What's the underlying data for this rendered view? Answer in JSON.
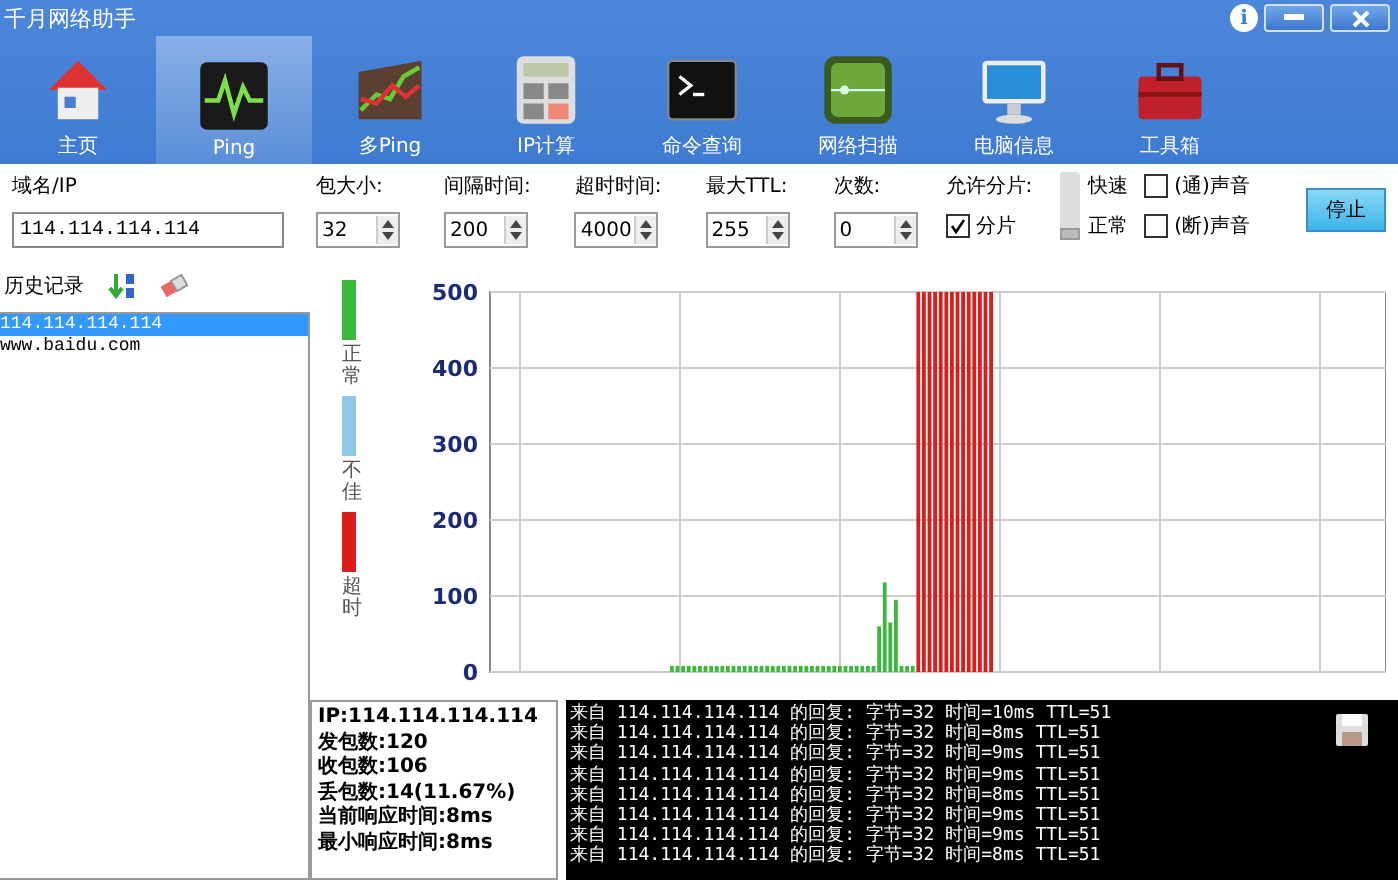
{
  "window": {
    "title": "千月网络助手",
    "info_glyph": "i"
  },
  "toolbar": [
    {
      "label": "主页",
      "selected": false
    },
    {
      "label": "Ping",
      "selected": true
    },
    {
      "label": "多Ping",
      "selected": false
    },
    {
      "label": "IP计算",
      "selected": false
    },
    {
      "label": "命令查询",
      "selected": false
    },
    {
      "label": "网络扫描",
      "selected": false
    },
    {
      "label": "电脑信息",
      "selected": false
    },
    {
      "label": "工具箱",
      "selected": false
    }
  ],
  "form": {
    "host": {
      "label": "域名/IP",
      "value": "114.114.114.114"
    },
    "spinners": [
      {
        "label": "包大小:",
        "value": "32"
      },
      {
        "label": "间隔时间:",
        "value": "200"
      },
      {
        "label": "超时时间:",
        "value": "4000"
      },
      {
        "label": "最大TTL:",
        "value": "255"
      },
      {
        "label": "次数:",
        "value": "0"
      }
    ],
    "fragment": {
      "label": "允许分片:",
      "checkbox": "分片",
      "checked": true
    },
    "speed": {
      "fast": "快速",
      "normal": "正常",
      "level": 0
    },
    "sounds": [
      {
        "label": "(通)声音",
        "checked": false
      },
      {
        "label": "(断)声音",
        "checked": false
      }
    ],
    "stop_button": "停止"
  },
  "history": {
    "title": "历史记录",
    "items": [
      {
        "text": "114.114.114.114",
        "selected": true
      },
      {
        "text": "www.baidu.com",
        "selected": false
      }
    ]
  },
  "legend": [
    {
      "label": "正常",
      "color": "#3cb93c"
    },
    {
      "label": "不佳",
      "color": "#8ecae6"
    },
    {
      "label": "超时",
      "color": "#dd1c1c"
    }
  ],
  "chart": {
    "chart_data": {
      "type": "bar",
      "ylim": [
        0,
        500
      ],
      "yticks": [
        0,
        100,
        200,
        300,
        400,
        500
      ],
      "grid": true,
      "series": [
        {
          "color": "#3cb93c",
          "values": [
            null,
            null,
            null,
            null,
            null,
            null,
            null,
            null,
            null,
            null,
            null,
            null,
            null,
            null,
            null,
            null,
            null,
            null,
            null,
            null,
            null,
            null,
            null,
            null,
            null,
            null,
            null,
            null,
            null,
            null,
            null,
            null,
            8,
            8,
            8,
            8,
            8,
            8,
            8,
            8,
            8,
            8,
            8,
            8,
            8,
            8,
            8,
            8,
            8,
            8,
            8,
            8,
            8,
            8,
            8,
            8,
            8,
            8,
            8,
            8,
            8,
            8,
            8,
            8,
            8,
            8,
            8,
            8,
            8,
            60,
            118,
            65,
            95,
            8,
            8,
            8,
            null,
            null,
            null,
            null,
            null,
            null,
            null,
            null,
            null,
            null,
            null,
            null,
            null,
            null,
            null,
            null,
            null,
            null,
            null,
            null,
            null,
            null,
            null,
            null,
            null,
            null,
            null,
            null,
            null,
            null,
            null,
            null,
            null,
            null,
            null,
            null,
            null,
            null,
            null,
            null,
            null,
            null,
            null,
            null,
            null,
            null,
            null,
            null,
            null,
            null,
            null,
            null,
            null,
            null,
            null,
            null,
            null,
            null,
            null,
            null,
            null,
            null,
            null,
            null,
            null,
            null,
            null,
            null,
            null,
            null,
            null,
            null,
            null,
            null,
            null,
            null,
            null,
            null,
            null,
            null,
            null,
            null,
            null,
            null
          ]
        },
        {
          "color": "#dd1c1c",
          "values": [
            null,
            null,
            null,
            null,
            null,
            null,
            null,
            null,
            null,
            null,
            null,
            null,
            null,
            null,
            null,
            null,
            null,
            null,
            null,
            null,
            null,
            null,
            null,
            null,
            null,
            null,
            null,
            null,
            null,
            null,
            null,
            null,
            null,
            null,
            null,
            null,
            null,
            null,
            null,
            null,
            null,
            null,
            null,
            null,
            null,
            null,
            null,
            null,
            null,
            null,
            null,
            null,
            null,
            null,
            null,
            null,
            null,
            null,
            null,
            null,
            null,
            null,
            null,
            null,
            null,
            null,
            null,
            null,
            null,
            null,
            null,
            null,
            null,
            null,
            null,
            null,
            500,
            500,
            500,
            500,
            500,
            500,
            500,
            500,
            500,
            500,
            500,
            500,
            500,
            500,
            null,
            null,
            null,
            null,
            null,
            null,
            null,
            null,
            null,
            null,
            null,
            null,
            null,
            null,
            null,
            null,
            null,
            null,
            null,
            null,
            null,
            null,
            null,
            null,
            null,
            null,
            null,
            null,
            null,
            null,
            null,
            null,
            null,
            null,
            null,
            null,
            null,
            null,
            null,
            null,
            null,
            null,
            null,
            null,
            null,
            null,
            null,
            null,
            null,
            null,
            null,
            null,
            null,
            null,
            null,
            null,
            null,
            null,
            null,
            null,
            null,
            null,
            null,
            null,
            null,
            null,
            null,
            null,
            null,
            null
          ]
        }
      ]
    }
  },
  "stats": [
    "IP:114.114.114.114",
    "发包数:120",
    "收包数:106",
    "丢包数:14(11.67%)",
    "当前响应时间:8ms",
    "最小响应时间:8ms"
  ],
  "log": [
    "来自 114.114.114.114 的回复: 字节=32 时间=10ms TTL=51",
    "来自 114.114.114.114 的回复: 字节=32 时间=8ms TTL=51",
    "来自 114.114.114.114 的回复: 字节=32 时间=9ms TTL=51",
    "来自 114.114.114.114 的回复: 字节=32 时间=9ms TTL=51",
    "来自 114.114.114.114 的回复: 字节=32 时间=8ms TTL=51",
    "来自 114.114.114.114 的回复: 字节=32 时间=9ms TTL=51",
    "来自 114.114.114.114 的回复: 字节=32 时间=9ms TTL=51",
    "来自 114.114.114.114 的回复: 字节=32 时间=8ms TTL=51"
  ]
}
